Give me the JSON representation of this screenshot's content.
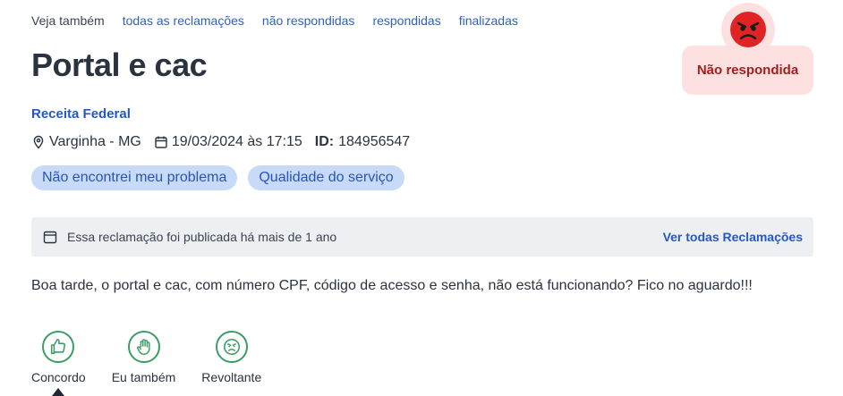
{
  "see_also": {
    "label": "Veja também",
    "links": [
      "todas as reclamações",
      "não respondidas",
      "respondidas",
      "finalizadas"
    ]
  },
  "complaint": {
    "title": "Portal e cac",
    "company": "Receita Federal",
    "location": "Varginha - MG",
    "datetime": "19/03/2024 às 17:15",
    "id_label": "ID:",
    "id_value": "184956547",
    "tags": [
      "Não encontrei meu problema",
      "Qualidade do serviço"
    ],
    "status": "Não respondida",
    "body": "Boa tarde, o portal e cac, com número CPF, código de acesso e senha, não está funcionando? Fico no aguardo!!!"
  },
  "notice": {
    "text": "Essa reclamação foi publicada há mais de 1 ano",
    "link": "Ver todas Reclamações"
  },
  "reactions": [
    {
      "label": "Concordo",
      "icon": "thumbs-up-icon"
    },
    {
      "label": "Eu também",
      "icon": "hand-icon"
    },
    {
      "label": "Revoltante",
      "icon": "angry-face-icon"
    }
  ],
  "colors": {
    "link": "#2f5fc4",
    "status_bg": "#fde1e1",
    "status_text": "#9e1e1e",
    "status_face": "#e02424",
    "tag_bg": "#c7daf7",
    "reaction_green": "#3c9e63"
  }
}
